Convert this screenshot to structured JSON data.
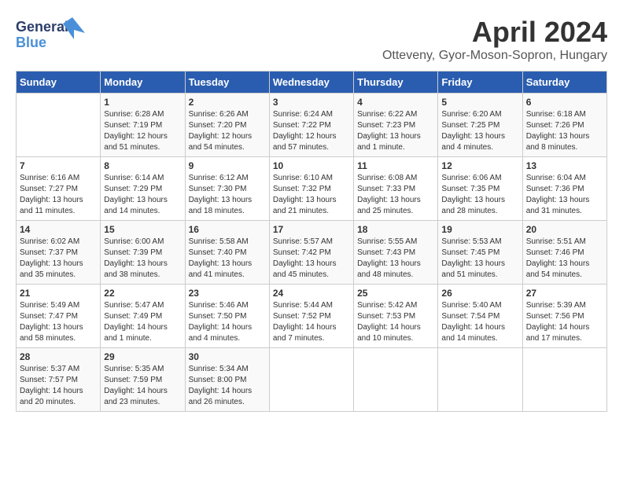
{
  "header": {
    "logo_line1": "General",
    "logo_line2": "Blue",
    "month_title": "April 2024",
    "location": "Otteveny, Gyor-Moson-Sopron, Hungary"
  },
  "days_of_week": [
    "Sunday",
    "Monday",
    "Tuesday",
    "Wednesday",
    "Thursday",
    "Friday",
    "Saturday"
  ],
  "weeks": [
    [
      {
        "day": "",
        "sunrise": "",
        "sunset": "",
        "daylight": ""
      },
      {
        "day": "1",
        "sunrise": "Sunrise: 6:28 AM",
        "sunset": "Sunset: 7:19 PM",
        "daylight": "Daylight: 12 hours and 51 minutes."
      },
      {
        "day": "2",
        "sunrise": "Sunrise: 6:26 AM",
        "sunset": "Sunset: 7:20 PM",
        "daylight": "Daylight: 12 hours and 54 minutes."
      },
      {
        "day": "3",
        "sunrise": "Sunrise: 6:24 AM",
        "sunset": "Sunset: 7:22 PM",
        "daylight": "Daylight: 12 hours and 57 minutes."
      },
      {
        "day": "4",
        "sunrise": "Sunrise: 6:22 AM",
        "sunset": "Sunset: 7:23 PM",
        "daylight": "Daylight: 13 hours and 1 minute."
      },
      {
        "day": "5",
        "sunrise": "Sunrise: 6:20 AM",
        "sunset": "Sunset: 7:25 PM",
        "daylight": "Daylight: 13 hours and 4 minutes."
      },
      {
        "day": "6",
        "sunrise": "Sunrise: 6:18 AM",
        "sunset": "Sunset: 7:26 PM",
        "daylight": "Daylight: 13 hours and 8 minutes."
      }
    ],
    [
      {
        "day": "7",
        "sunrise": "Sunrise: 6:16 AM",
        "sunset": "Sunset: 7:27 PM",
        "daylight": "Daylight: 13 hours and 11 minutes."
      },
      {
        "day": "8",
        "sunrise": "Sunrise: 6:14 AM",
        "sunset": "Sunset: 7:29 PM",
        "daylight": "Daylight: 13 hours and 14 minutes."
      },
      {
        "day": "9",
        "sunrise": "Sunrise: 6:12 AM",
        "sunset": "Sunset: 7:30 PM",
        "daylight": "Daylight: 13 hours and 18 minutes."
      },
      {
        "day": "10",
        "sunrise": "Sunrise: 6:10 AM",
        "sunset": "Sunset: 7:32 PM",
        "daylight": "Daylight: 13 hours and 21 minutes."
      },
      {
        "day": "11",
        "sunrise": "Sunrise: 6:08 AM",
        "sunset": "Sunset: 7:33 PM",
        "daylight": "Daylight: 13 hours and 25 minutes."
      },
      {
        "day": "12",
        "sunrise": "Sunrise: 6:06 AM",
        "sunset": "Sunset: 7:35 PM",
        "daylight": "Daylight: 13 hours and 28 minutes."
      },
      {
        "day": "13",
        "sunrise": "Sunrise: 6:04 AM",
        "sunset": "Sunset: 7:36 PM",
        "daylight": "Daylight: 13 hours and 31 minutes."
      }
    ],
    [
      {
        "day": "14",
        "sunrise": "Sunrise: 6:02 AM",
        "sunset": "Sunset: 7:37 PM",
        "daylight": "Daylight: 13 hours and 35 minutes."
      },
      {
        "day": "15",
        "sunrise": "Sunrise: 6:00 AM",
        "sunset": "Sunset: 7:39 PM",
        "daylight": "Daylight: 13 hours and 38 minutes."
      },
      {
        "day": "16",
        "sunrise": "Sunrise: 5:58 AM",
        "sunset": "Sunset: 7:40 PM",
        "daylight": "Daylight: 13 hours and 41 minutes."
      },
      {
        "day": "17",
        "sunrise": "Sunrise: 5:57 AM",
        "sunset": "Sunset: 7:42 PM",
        "daylight": "Daylight: 13 hours and 45 minutes."
      },
      {
        "day": "18",
        "sunrise": "Sunrise: 5:55 AM",
        "sunset": "Sunset: 7:43 PM",
        "daylight": "Daylight: 13 hours and 48 minutes."
      },
      {
        "day": "19",
        "sunrise": "Sunrise: 5:53 AM",
        "sunset": "Sunset: 7:45 PM",
        "daylight": "Daylight: 13 hours and 51 minutes."
      },
      {
        "day": "20",
        "sunrise": "Sunrise: 5:51 AM",
        "sunset": "Sunset: 7:46 PM",
        "daylight": "Daylight: 13 hours and 54 minutes."
      }
    ],
    [
      {
        "day": "21",
        "sunrise": "Sunrise: 5:49 AM",
        "sunset": "Sunset: 7:47 PM",
        "daylight": "Daylight: 13 hours and 58 minutes."
      },
      {
        "day": "22",
        "sunrise": "Sunrise: 5:47 AM",
        "sunset": "Sunset: 7:49 PM",
        "daylight": "Daylight: 14 hours and 1 minute."
      },
      {
        "day": "23",
        "sunrise": "Sunrise: 5:46 AM",
        "sunset": "Sunset: 7:50 PM",
        "daylight": "Daylight: 14 hours and 4 minutes."
      },
      {
        "day": "24",
        "sunrise": "Sunrise: 5:44 AM",
        "sunset": "Sunset: 7:52 PM",
        "daylight": "Daylight: 14 hours and 7 minutes."
      },
      {
        "day": "25",
        "sunrise": "Sunrise: 5:42 AM",
        "sunset": "Sunset: 7:53 PM",
        "daylight": "Daylight: 14 hours and 10 minutes."
      },
      {
        "day": "26",
        "sunrise": "Sunrise: 5:40 AM",
        "sunset": "Sunset: 7:54 PM",
        "daylight": "Daylight: 14 hours and 14 minutes."
      },
      {
        "day": "27",
        "sunrise": "Sunrise: 5:39 AM",
        "sunset": "Sunset: 7:56 PM",
        "daylight": "Daylight: 14 hours and 17 minutes."
      }
    ],
    [
      {
        "day": "28",
        "sunrise": "Sunrise: 5:37 AM",
        "sunset": "Sunset: 7:57 PM",
        "daylight": "Daylight: 14 hours and 20 minutes."
      },
      {
        "day": "29",
        "sunrise": "Sunrise: 5:35 AM",
        "sunset": "Sunset: 7:59 PM",
        "daylight": "Daylight: 14 hours and 23 minutes."
      },
      {
        "day": "30",
        "sunrise": "Sunrise: 5:34 AM",
        "sunset": "Sunset: 8:00 PM",
        "daylight": "Daylight: 14 hours and 26 minutes."
      },
      {
        "day": "",
        "sunrise": "",
        "sunset": "",
        "daylight": ""
      },
      {
        "day": "",
        "sunrise": "",
        "sunset": "",
        "daylight": ""
      },
      {
        "day": "",
        "sunrise": "",
        "sunset": "",
        "daylight": ""
      },
      {
        "day": "",
        "sunrise": "",
        "sunset": "",
        "daylight": ""
      }
    ]
  ]
}
